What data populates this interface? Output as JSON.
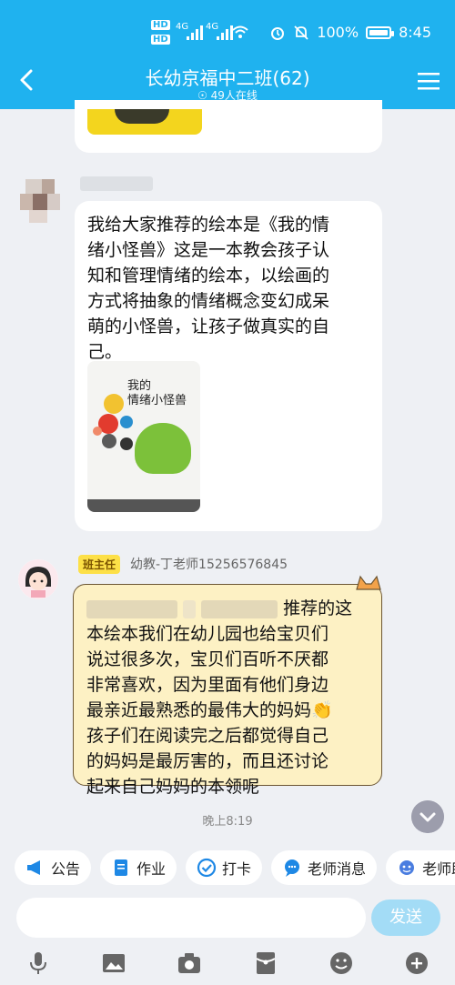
{
  "status_bar": {
    "network_left": "HD",
    "signal1": "4G",
    "signal2": "4G",
    "battery": "100%",
    "time": "8:45"
  },
  "header": {
    "title": "长幼京福中二班(62)",
    "online": "49人在线"
  },
  "messages": {
    "msg1_lines": [
      "我给大家推荐的绘本是《我的情",
      "绪小怪兽》这是一本教会孩子认",
      "知和管理情绪的绘本，以绘画的",
      "方式将抽象的情绪概念变幻成呆",
      "萌的小怪兽，让孩子做真实的自",
      "己。"
    ],
    "book_title_lines": [
      "我的",
      "情绪小怪兽"
    ],
    "teacher_badge": "班主任",
    "teacher_name": "幼教-丁老师15256576845",
    "msg2_first_suffix": "推荐的这",
    "msg2_lines": [
      "本绘本我们在幼儿园也给宝贝们",
      "说过很多次，宝贝们百听不厌都",
      "非常喜欢，因为里面有他们身边",
      "最亲近最熟悉的最伟大的妈妈👏",
      "孩子们在阅读完之后都觉得自己",
      "的妈妈是最厉害的，而且还讨论",
      "起来自己妈妈的本领呢"
    ],
    "timestamp": "晚上8:19"
  },
  "quick_actions": [
    {
      "label": "公告",
      "icon": "megaphone-icon"
    },
    {
      "label": "作业",
      "icon": "document-icon"
    },
    {
      "label": "打卡",
      "icon": "checkin-icon"
    },
    {
      "label": "老师消息",
      "icon": "chat-icon"
    },
    {
      "label": "老师助",
      "icon": "teacher-icon"
    }
  ],
  "input": {
    "placeholder": "",
    "send_label": "发送"
  },
  "colors": {
    "header": "#1fb2ef",
    "send_button": "#a3dcf6",
    "note_bg": "#fdf1c4"
  }
}
